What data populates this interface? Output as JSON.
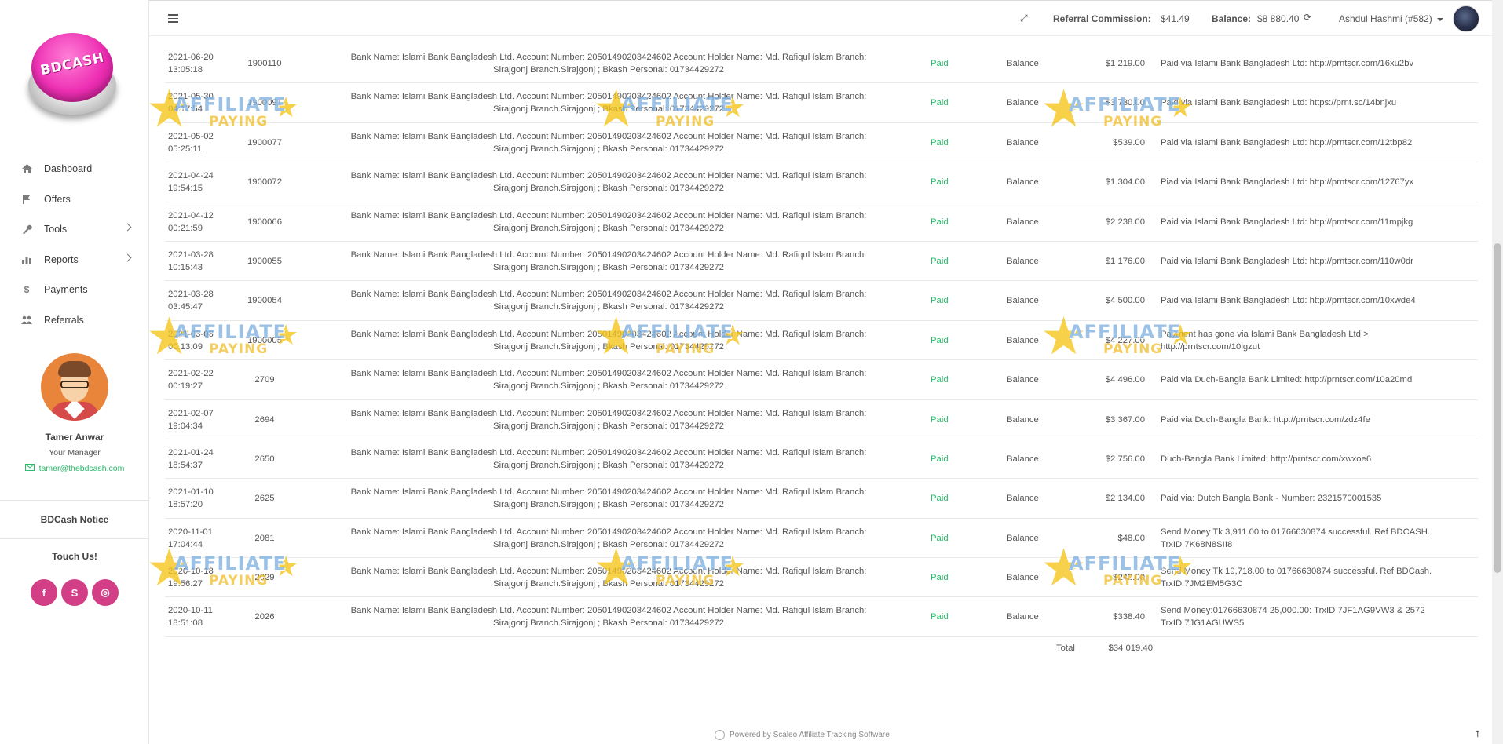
{
  "brand": {
    "logo_text": "BDCASH"
  },
  "sidebar": {
    "items": [
      {
        "label": "Dashboard",
        "icon": "home-icon"
      },
      {
        "label": "Offers",
        "icon": "flag-icon"
      },
      {
        "label": "Tools",
        "icon": "wrench-icon",
        "has_submenu": true
      },
      {
        "label": "Reports",
        "icon": "bar-chart-icon",
        "has_submenu": true
      },
      {
        "label": "Payments",
        "icon": "dollar-icon"
      },
      {
        "label": "Referrals",
        "icon": "users-icon"
      }
    ],
    "manager": {
      "name": "Tamer Anwar",
      "role": "Your Manager",
      "email": "tamer@thebdcash.com"
    },
    "notice": "BDCash Notice",
    "touch": "Touch Us!",
    "social": [
      "f",
      "S",
      "◎"
    ]
  },
  "topbar": {
    "referral_label": "Referral Commission:",
    "referral_value": "$41.49",
    "balance_label": "Balance:",
    "balance_value": "$8 880.40",
    "user": "Ashdul Hashmi (#582)"
  },
  "payments": {
    "rows": [
      {
        "date": "2021-06-20",
        "time": "13:05:18",
        "id": "1900110",
        "info1": "Bank Name: Islami Bank Bangladesh Ltd. Account Number: 20501490203424602 Account Holder Name: Md. Rafiqul Islam Branch:",
        "info2": "Sirajgonj Branch.Sirajgonj ; Bkash Personal: 01734429272",
        "status": "Paid",
        "type": "Balance",
        "amount": "$1 219.00",
        "comment1": "Paid via Islami Bank Bangladesh Ltd: http://prntscr.com/16xu2bv",
        "comment2": ""
      },
      {
        "date": "2021-05-30",
        "time": "04:17:54",
        "id": "1900091",
        "info1": "Bank Name: Islami Bank Bangladesh Ltd. Account Number: 20501490203424602 Account Holder Name: Md. Rafiqul Islam Branch:",
        "info2": "Sirajgonj Branch.Sirajgonj ; Bkash Personal: 01734429272",
        "status": "Paid",
        "type": "Balance",
        "amount": "$3 730.00",
        "comment1": "Paid via Islami Bank Bangladesh Ltd: https://prnt.sc/14bnjxu",
        "comment2": ""
      },
      {
        "date": "2021-05-02",
        "time": "05:25:11",
        "id": "1900077",
        "info1": "Bank Name: Islami Bank Bangladesh Ltd. Account Number: 20501490203424602 Account Holder Name: Md. Rafiqul Islam Branch:",
        "info2": "Sirajgonj Branch.Sirajgonj ; Bkash Personal: 01734429272",
        "status": "Paid",
        "type": "Balance",
        "amount": "$539.00",
        "comment1": "Paid via Islami Bank Bangladesh Ltd: http://prntscr.com/12tbp82",
        "comment2": ""
      },
      {
        "date": "2021-04-24",
        "time": "19:54:15",
        "id": "1900072",
        "info1": "Bank Name: Islami Bank Bangladesh Ltd. Account Number: 20501490203424602 Account Holder Name: Md. Rafiqul Islam Branch:",
        "info2": "Sirajgonj Branch.Sirajgonj ; Bkash Personal: 01734429272",
        "status": "Paid",
        "type": "Balance",
        "amount": "$1 304.00",
        "comment1": "Piad via Islami Bank Bangladesh Ltd: http://prntscr.com/12767yx",
        "comment2": ""
      },
      {
        "date": "2021-04-12",
        "time": "00:21:59",
        "id": "1900066",
        "info1": "Bank Name: Islami Bank Bangladesh Ltd. Account Number: 20501490203424602 Account Holder Name: Md. Rafiqul Islam Branch:",
        "info2": "Sirajgonj Branch.Sirajgonj ; Bkash Personal: 01734429272",
        "status": "Paid",
        "type": "Balance",
        "amount": "$2 238.00",
        "comment1": "Paid via Islami Bank Bangladesh Ltd: http://prntscr.com/11mpjkg",
        "comment2": ""
      },
      {
        "date": "2021-03-28",
        "time": "10:15:43",
        "id": "1900055",
        "info1": "Bank Name: Islami Bank Bangladesh Ltd. Account Number: 20501490203424602 Account Holder Name: Md. Rafiqul Islam Branch:",
        "info2": "Sirajgonj Branch.Sirajgonj ; Bkash Personal: 01734429272",
        "status": "Paid",
        "type": "Balance",
        "amount": "$1 176.00",
        "comment1": "Paid via Islami Bank Bangladesh Ltd: http://prntscr.com/110w0dr",
        "comment2": ""
      },
      {
        "date": "2021-03-28",
        "time": "03:45:47",
        "id": "1900054",
        "info1": "Bank Name: Islami Bank Bangladesh Ltd. Account Number: 20501490203424602 Account Holder Name: Md. Rafiqul Islam Branch:",
        "info2": "Sirajgonj Branch.Sirajgonj ; Bkash Personal: 01734429272",
        "status": "Paid",
        "type": "Balance",
        "amount": "$4 500.00",
        "comment1": "Paid via Islami Bank Bangladesh Ltd: http://prntscr.com/10xwde4",
        "comment2": ""
      },
      {
        "date": "2021-03-08",
        "time": "00:13:09",
        "id": "1900005",
        "info1": "Bank Name: Islami Bank Bangladesh Ltd. Account Number: 20501490203424602 Account Holder Name: Md. Rafiqul Islam Branch:",
        "info2": "Sirajgonj Branch.Sirajgonj ; Bkash Personal: 01734429272",
        "status": "Paid",
        "type": "Balance",
        "amount": "$4 227.00",
        "comment1": "Payment has gone via Islami Bank Bangladesh Ltd >",
        "comment2": "http://prntscr.com/10lgzut"
      },
      {
        "date": "2021-02-22",
        "time": "00:19:27",
        "id": "2709",
        "info1": "Bank Name: Islami Bank Bangladesh Ltd. Account Number: 20501490203424602 Account Holder Name: Md. Rafiqul Islam Branch:",
        "info2": "Sirajgonj Branch.Sirajgonj ; Bkash Personal: 01734429272",
        "status": "Paid",
        "type": "Balance",
        "amount": "$4 496.00",
        "comment1": "Paid via Duch-Bangla Bank Limited: http://prntscr.com/10a20md",
        "comment2": ""
      },
      {
        "date": "2021-02-07",
        "time": "19:04:34",
        "id": "2694",
        "info1": "Bank Name: Islami Bank Bangladesh Ltd. Account Number: 20501490203424602 Account Holder Name: Md. Rafiqul Islam Branch:",
        "info2": "Sirajgonj Branch.Sirajgonj ; Bkash Personal: 01734429272",
        "status": "Paid",
        "type": "Balance",
        "amount": "$3 367.00",
        "comment1": "Paid via Duch-Bangla Bank: http://prntscr.com/zdz4fe",
        "comment2": ""
      },
      {
        "date": "2021-01-24",
        "time": "18:54:37",
        "id": "2650",
        "info1": "Bank Name: Islami Bank Bangladesh Ltd. Account Number: 20501490203424602 Account Holder Name: Md. Rafiqul Islam Branch:",
        "info2": "Sirajgonj Branch.Sirajgonj ; Bkash Personal: 01734429272",
        "status": "Paid",
        "type": "Balance",
        "amount": "$2 756.00",
        "comment1": "Duch-Bangla Bank Limited: http://prntscr.com/xwxoe6",
        "comment2": ""
      },
      {
        "date": "2021-01-10",
        "time": "18:57:20",
        "id": "2625",
        "info1": "Bank Name: Islami Bank Bangladesh Ltd. Account Number: 20501490203424602 Account Holder Name: Md. Rafiqul Islam Branch:",
        "info2": "Sirajgonj Branch.Sirajgonj ; Bkash Personal: 01734429272",
        "status": "Paid",
        "type": "Balance",
        "amount": "$2 134.00",
        "comment1": "Paid via: Dutch Bangla Bank - Number: 2321570001535",
        "comment2": ""
      },
      {
        "date": "2020-11-01",
        "time": "17:04:44",
        "id": "2081",
        "info1": "Bank Name: Islami Bank Bangladesh Ltd. Account Number: 20501490203424602 Account Holder Name: Md. Rafiqul Islam Branch:",
        "info2": "Sirajgonj Branch.Sirajgonj ; Bkash Personal: 01734429272",
        "status": "Paid",
        "type": "Balance",
        "amount": "$48.00",
        "comment1": "Send Money Tk 3,911.00 to 01766630874 successful. Ref BDCASH.",
        "comment2": "TrxID 7K68N8SII8"
      },
      {
        "date": "2020-10-18",
        "time": "19:56:27",
        "id": "2029",
        "info1": "Bank Name: Islami Bank Bangladesh Ltd. Account Number: 20501490203424602 Account Holder Name: Md. Rafiqul Islam Branch:",
        "info2": "Sirajgonj Branch.Sirajgonj ; Bkash Personal: 01734429272",
        "status": "Paid",
        "type": "Balance",
        "amount": "$242.00",
        "comment1": "Send Money Tk 19,718.00 to 01766630874 successful. Ref BDCash.",
        "comment2": "TrxID 7JM2EM5G3C"
      },
      {
        "date": "2020-10-11",
        "time": "18:51:08",
        "id": "2026",
        "info1": "Bank Name: Islami Bank Bangladesh Ltd. Account Number: 20501490203424602 Account Holder Name: Md. Rafiqul Islam Branch:",
        "info2": "Sirajgonj Branch.Sirajgonj ; Bkash Personal: 01734429272",
        "status": "Paid",
        "type": "Balance",
        "amount": "$338.40",
        "comment1": "Send Money:01766630874 25,000.00: TrxID 7JF1AG9VW3 & 2572",
        "comment2": "TrxID 7JG1AGUWS5"
      }
    ],
    "total_label": "Total",
    "total_value": "$34 019.40"
  },
  "footer": {
    "text": "Powered by Scaleo Affiliate Tracking Software"
  },
  "watermark": {
    "line1": "AFFILIATE",
    "line2": "PAYING"
  },
  "colors": {
    "status_paid": "#2aba6a",
    "social": "#d23f86",
    "logo": "#ee2fb4"
  }
}
